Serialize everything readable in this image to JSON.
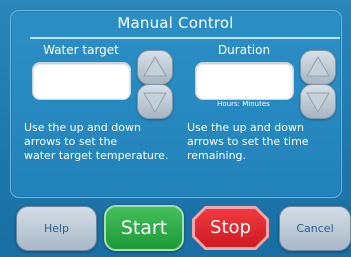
{
  "panel": {
    "title": "Manual Control"
  },
  "water_target": {
    "label": "Water target",
    "value": "",
    "instructions": [
      "Use the up and down",
      "arrows to set the",
      "water target temperature."
    ]
  },
  "duration": {
    "label": "Duration",
    "value": "",
    "units": "Hours: Minutes",
    "instructions": [
      "Use the up and down",
      "arrows to set the time",
      "remaining."
    ]
  },
  "buttons": {
    "help": "Help",
    "start": "Start",
    "stop": "Stop",
    "cancel": "Cancel"
  },
  "colors": {
    "background": "#1d78ae",
    "panel": "#2283ba",
    "start": "#2aa845",
    "stop": "#e8262e",
    "secondary_button": "#b7c5d2"
  },
  "icons": {
    "up": "triangle-up-icon",
    "down": "triangle-down-icon"
  }
}
